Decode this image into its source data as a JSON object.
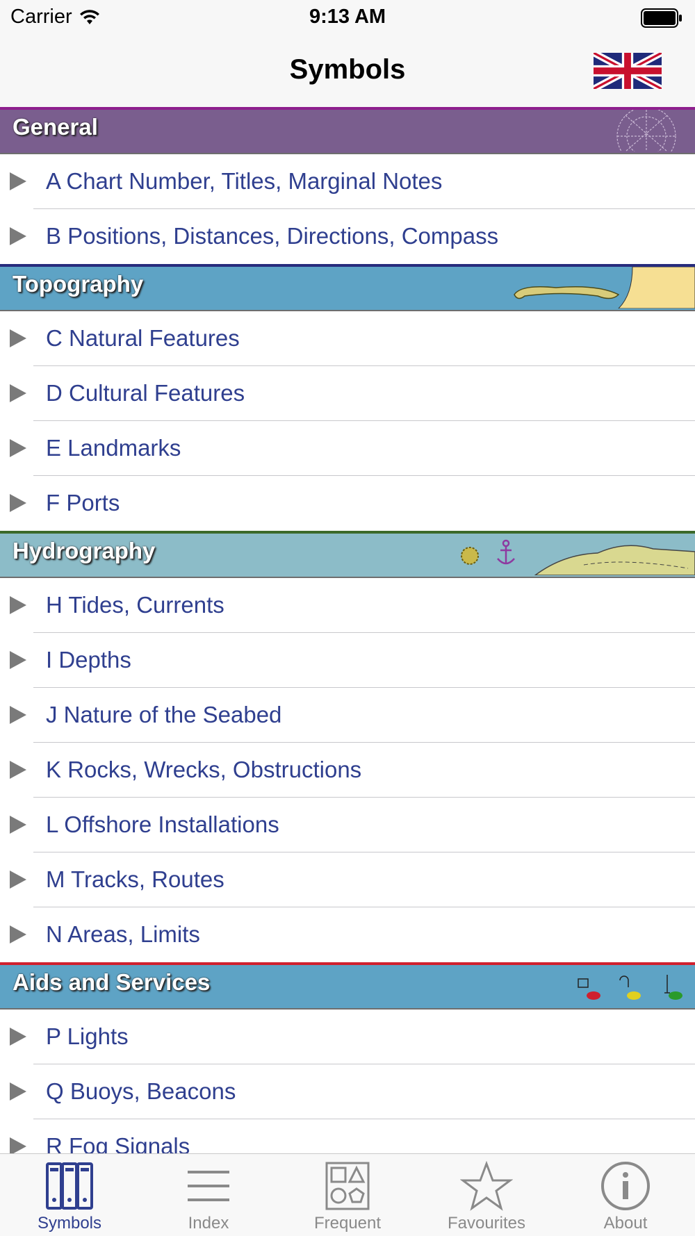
{
  "status_bar": {
    "carrier": "Carrier",
    "time": "9:13 AM"
  },
  "nav": {
    "title": "Symbols",
    "language_flag": "uk-flag-icon"
  },
  "sections": [
    {
      "title": "General",
      "color": "#7a5e8e",
      "border": "#8e1f8e",
      "items": [
        "A Chart Number, Titles, Marginal Notes",
        "B Positions, Distances, Directions, Compass"
      ]
    },
    {
      "title": "Topography",
      "color": "#5ea3c5",
      "border": "#272b7c",
      "items": [
        "C Natural Features",
        "D Cultural Features",
        "E Landmarks",
        "F Ports"
      ]
    },
    {
      "title": "Hydrography",
      "color": "#8cbcc8",
      "border": "#3c6a2a",
      "items": [
        "H Tides, Currents",
        "I Depths",
        "J Nature of the Seabed",
        "K Rocks, Wrecks, Obstructions",
        "L Offshore Installations",
        "M Tracks, Routes",
        "N Areas, Limits"
      ]
    },
    {
      "title": "Aids and Services",
      "color": "#5ea3c5",
      "border": "#d0202e",
      "items": [
        "P Lights",
        "Q Buoys, Beacons",
        "R Fog Signals"
      ]
    }
  ],
  "tabs": [
    {
      "label": "Symbols",
      "icon": "binders-icon",
      "active": true
    },
    {
      "label": "Index",
      "icon": "list-lines-icon",
      "active": false
    },
    {
      "label": "Frequent",
      "icon": "shapes-icon",
      "active": false
    },
    {
      "label": "Favourites",
      "icon": "star-icon",
      "active": false
    },
    {
      "label": "About",
      "icon": "info-icon",
      "active": false
    }
  ],
  "colors": {
    "accent": "#2f3f8f",
    "inactive_tab": "#8a8a8a"
  }
}
